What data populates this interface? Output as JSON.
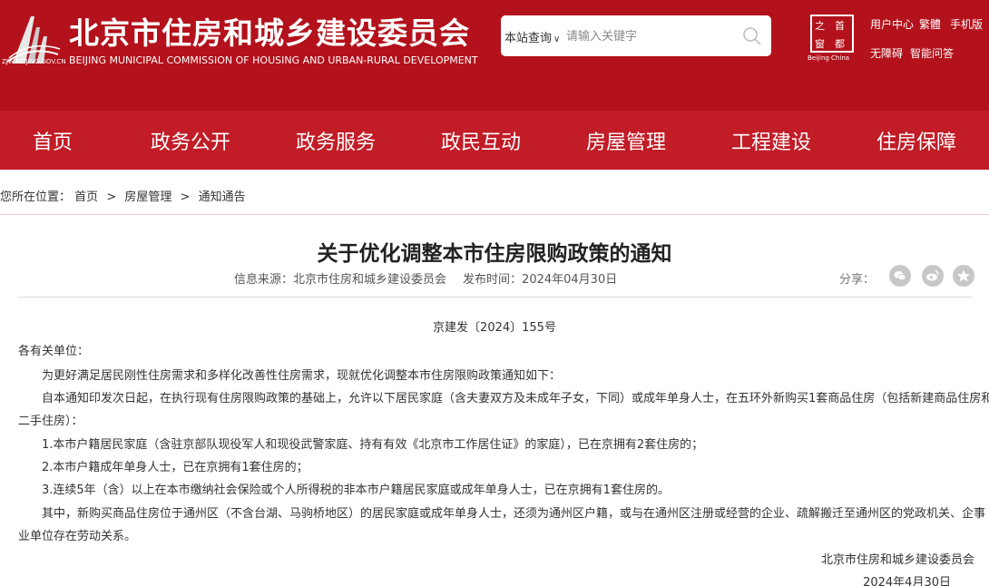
{
  "header": {
    "logo_url": "ZJW.BEIJING.GOV.CN",
    "site_title": "北京市住房和城乡建设委员会",
    "site_subtitle": "BEIJING MUNICIPAL COMMISSION OF HOUSING AND URBAN-RURAL DEVELOPMENT",
    "search": {
      "scope": "本站查询",
      "placeholder": "请输入关键字"
    },
    "capital_logo": {
      "chars": [
        "之",
        "首",
        "窗",
        "都"
      ],
      "caption": "Beijing·China"
    },
    "links": [
      "用户中心",
      "繁體",
      "手机版"
    ],
    "links2": [
      "无障碍",
      "智能问答"
    ]
  },
  "nav": {
    "items": [
      "首页",
      "政务公开",
      "政务服务",
      "政民互动",
      "房屋管理",
      "工程建设",
      "住房保障"
    ]
  },
  "breadcrumb": {
    "prefix": "您所在位置：",
    "items": [
      "首页",
      "房屋管理",
      "通知通告"
    ],
    "separator": ">"
  },
  "article": {
    "title": "关于优化调整本市住房限购政策的通知",
    "source_label": "信息来源：",
    "source": "北京市住房和城乡建设委员会",
    "date_label": "发布时间：",
    "date": "2024年04月30日",
    "share_label": "分享：",
    "share_icons": [
      "wechat-icon",
      "weibo-icon",
      "favorite-icon"
    ],
    "doc_number": "京建发〔2024〕155号",
    "salutation": "各有关单位：",
    "paragraphs": [
      "为更好满足居民刚性住房需求和多样化改善性住房需求，现就优化调整本市住房限购政策通知如下：",
      "自本通知印发次日起，在执行现有住房限购政策的基础上，允许以下居民家庭（含夫妻双方及未成年子女，下同）或成年单身人士，在五环外新购买1套商品住房（包括新建商品住房和",
      "二手住房）：",
      "1.本市户籍居民家庭（含驻京部队现役军人和现役武警家庭、持有有效《北京市工作居住证》的家庭），已在京拥有2套住房的；",
      "2.本市户籍成年单身人士，已在京拥有1套住房的；",
      "3.连续5年（含）以上在本市缴纳社会保险或个人所得税的非本市户籍居民家庭或成年单身人士，已在京拥有1套住房的。",
      "其中，新购买商品住房位于通州区（不含台湖、马驹桥地区）的居民家庭或成年单身人士，还须为通州区户籍，或与在通州区注册或经营的企业、疏解搬迁至通州区的党政机关、企事",
      "业单位存在劳动关系。"
    ],
    "signature": "北京市住房和城乡建设委员会",
    "signature_date": "2024年4月30日"
  }
}
